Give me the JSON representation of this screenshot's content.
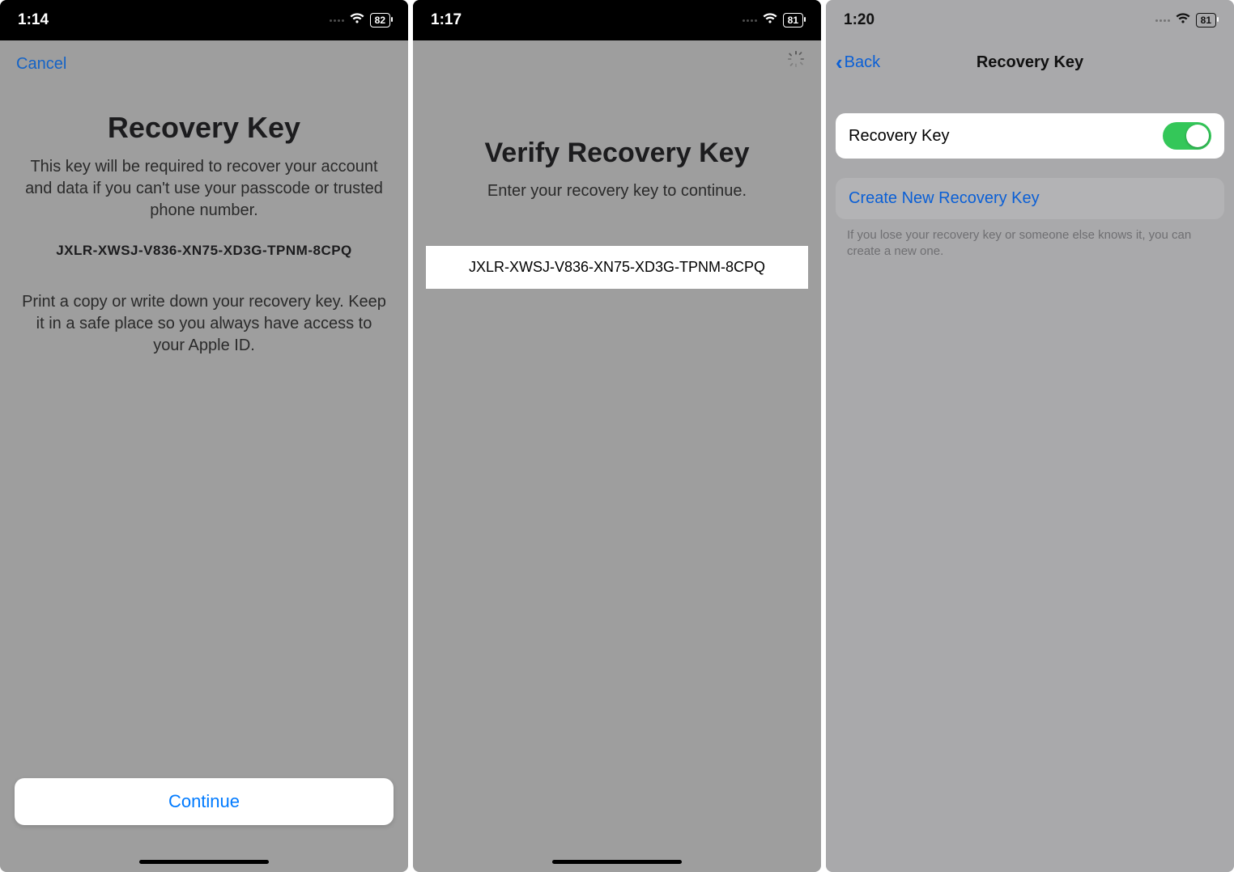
{
  "screen1": {
    "status": {
      "time": "1:14",
      "battery": "82"
    },
    "cancel": "Cancel",
    "title": "Recovery Key",
    "desc": "This key will be required to recover your account and data if you can't use your passcode or trusted phone number.",
    "key": "JXLR-XWSJ-V836-XN75-XD3G-TPNM-8CPQ",
    "note": "Print a copy or write down your recovery key. Keep it in a safe place so you always have access to your Apple ID.",
    "continue": "Continue"
  },
  "screen2": {
    "status": {
      "time": "1:17",
      "battery": "81"
    },
    "title": "Verify Recovery Key",
    "sub": "Enter your recovery key to continue.",
    "input_value": "JXLR-XWSJ-V836-XN75-XD3G-TPNM-8CPQ"
  },
  "screen3": {
    "status": {
      "time": "1:20",
      "battery": "81"
    },
    "back": "Back",
    "nav_title": "Recovery Key",
    "toggle_label": "Recovery Key",
    "create_new": "Create New Recovery Key",
    "note": "If you lose your recovery key or someone else knows it, you can create a new one."
  }
}
